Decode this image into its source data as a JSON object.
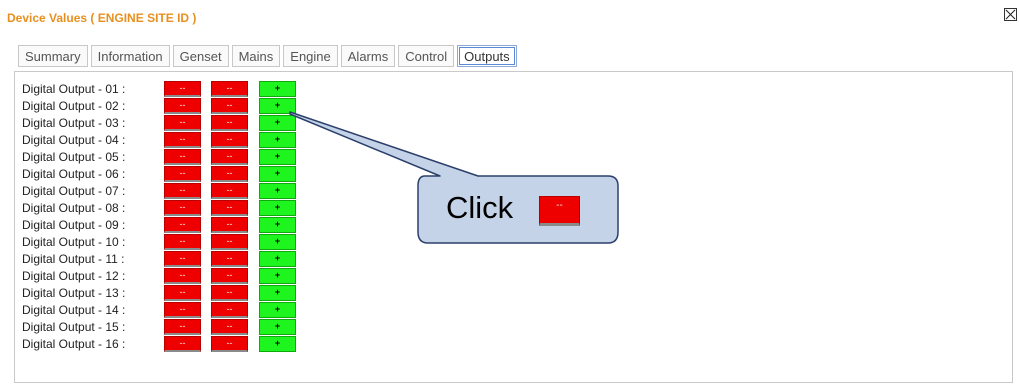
{
  "window": {
    "title": "Device Values ( ENGINE SITE ID )",
    "close_icon": "close-icon"
  },
  "tabs": [
    {
      "label": "Summary"
    },
    {
      "label": "Information"
    },
    {
      "label": "Genset"
    },
    {
      "label": "Mains"
    },
    {
      "label": "Engine"
    },
    {
      "label": "Alarms"
    },
    {
      "label": "Control"
    },
    {
      "label": "Outputs",
      "active": true
    }
  ],
  "outputs": [
    {
      "label": "Digital Output - 01 :",
      "off1": "--",
      "off2": "--",
      "on": "+"
    },
    {
      "label": "Digital Output - 02 :",
      "off1": "--",
      "off2": "--",
      "on": "+"
    },
    {
      "label": "Digital Output - 03 :",
      "off1": "--",
      "off2": "--",
      "on": "+"
    },
    {
      "label": "Digital Output - 04 :",
      "off1": "--",
      "off2": "--",
      "on": "+"
    },
    {
      "label": "Digital Output - 05 :",
      "off1": "--",
      "off2": "--",
      "on": "+"
    },
    {
      "label": "Digital Output - 06 :",
      "off1": "--",
      "off2": "--",
      "on": "+"
    },
    {
      "label": "Digital Output - 07 :",
      "off1": "--",
      "off2": "--",
      "on": "+"
    },
    {
      "label": "Digital Output - 08 :",
      "off1": "--",
      "off2": "--",
      "on": "+"
    },
    {
      "label": "Digital Output - 09 :",
      "off1": "--",
      "off2": "--",
      "on": "+"
    },
    {
      "label": "Digital Output - 10 :",
      "off1": "--",
      "off2": "--",
      "on": "+"
    },
    {
      "label": "Digital Output - 11 :",
      "off1": "--",
      "off2": "--",
      "on": "+"
    },
    {
      "label": "Digital Output - 12 :",
      "off1": "--",
      "off2": "--",
      "on": "+"
    },
    {
      "label": "Digital Output - 13 :",
      "off1": "--",
      "off2": "--",
      "on": "+"
    },
    {
      "label": "Digital Output - 14 :",
      "off1": "--",
      "off2": "--",
      "on": "+"
    },
    {
      "label": "Digital Output - 15 :",
      "off1": "--",
      "off2": "--",
      "on": "+"
    },
    {
      "label": "Digital Output - 16 :",
      "off1": "--",
      "off2": "--",
      "on": "+"
    }
  ],
  "callout": {
    "text": "Click",
    "chip_label": "--"
  },
  "colors": {
    "title": "#e8901f",
    "off": "#ee0000",
    "on": "#1ef51e",
    "callout_fill": "#c5d3e8"
  }
}
